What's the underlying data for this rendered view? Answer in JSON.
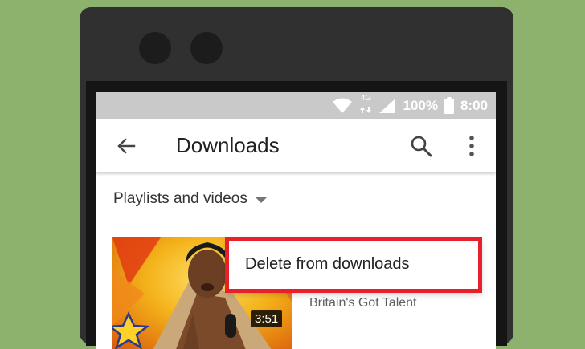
{
  "status_bar": {
    "network_type": "4G",
    "battery_percent": "100%",
    "time": "8:00",
    "icons": [
      "wifi-icon",
      "signal-icon",
      "battery-icon"
    ]
  },
  "app_bar": {
    "title": "Downloads",
    "icons": [
      "back-arrow-icon",
      "search-icon",
      "more-vert-icon"
    ]
  },
  "filter": {
    "label": "Playlists and videos"
  },
  "video": {
    "duration": "3:51",
    "channel": "Britain's Got Talent"
  },
  "context_menu": {
    "items": [
      {
        "label": "Delete from downloads"
      }
    ],
    "highlight_color": "#e8202a"
  },
  "colors": {
    "background": "#8db26d",
    "phone_body": "#303030",
    "status_bar": "#c9c9c9"
  }
}
